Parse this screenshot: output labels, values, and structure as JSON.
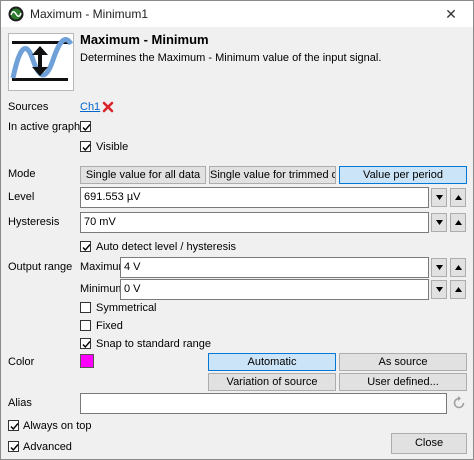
{
  "window": {
    "title": "Maximum - Minimum1",
    "close_glyph": "✕",
    "app_icon": "waveform-app-icon"
  },
  "header": {
    "title": "Maximum - Minimum",
    "description": "Determines the Maximum - Minimum value of the input signal.",
    "icon": "max-min-waveform-icon"
  },
  "sources": {
    "label": "Sources",
    "channel": "Ch1",
    "remove_icon": "red-x-remove-icon",
    "remove_color": "#d9242b"
  },
  "in_active_graph": {
    "label": "In active graph",
    "checked": true
  },
  "visible": {
    "label": "Visible",
    "checked": true
  },
  "mode": {
    "label": "Mode",
    "options": [
      "Single value for all data",
      "Single value for trimmed data",
      "Value per period"
    ],
    "selected": "Value per period"
  },
  "level": {
    "label": "Level",
    "value": "691.553 µV"
  },
  "hysteresis": {
    "label": "Hysteresis",
    "value": "70 mV"
  },
  "auto_detect": {
    "label": "Auto detect level / hysteresis",
    "checked": true
  },
  "output_range": {
    "label": "Output range",
    "maximum_label": "Maximum",
    "maximum_value": "4 V",
    "minimum_label": "Minimum",
    "minimum_value": "0 V"
  },
  "symmetrical": {
    "label": "Symmetrical",
    "checked": false
  },
  "fixed": {
    "label": "Fixed",
    "checked": false
  },
  "snap": {
    "label": "Snap to standard range",
    "checked": true
  },
  "color": {
    "label": "Color",
    "swatch": "#ff00ff",
    "automatic": "Automatic",
    "as_source": "As source",
    "variation": "Variation of source",
    "user_defined": "User defined...",
    "selected": "Automatic"
  },
  "alias": {
    "label": "Alias",
    "value": "",
    "reset_icon": "refresh-icon"
  },
  "always_on_top": {
    "label": "Always on top",
    "checked": true
  },
  "advanced": {
    "label": "Advanced",
    "checked": true
  },
  "close_button": "Close"
}
